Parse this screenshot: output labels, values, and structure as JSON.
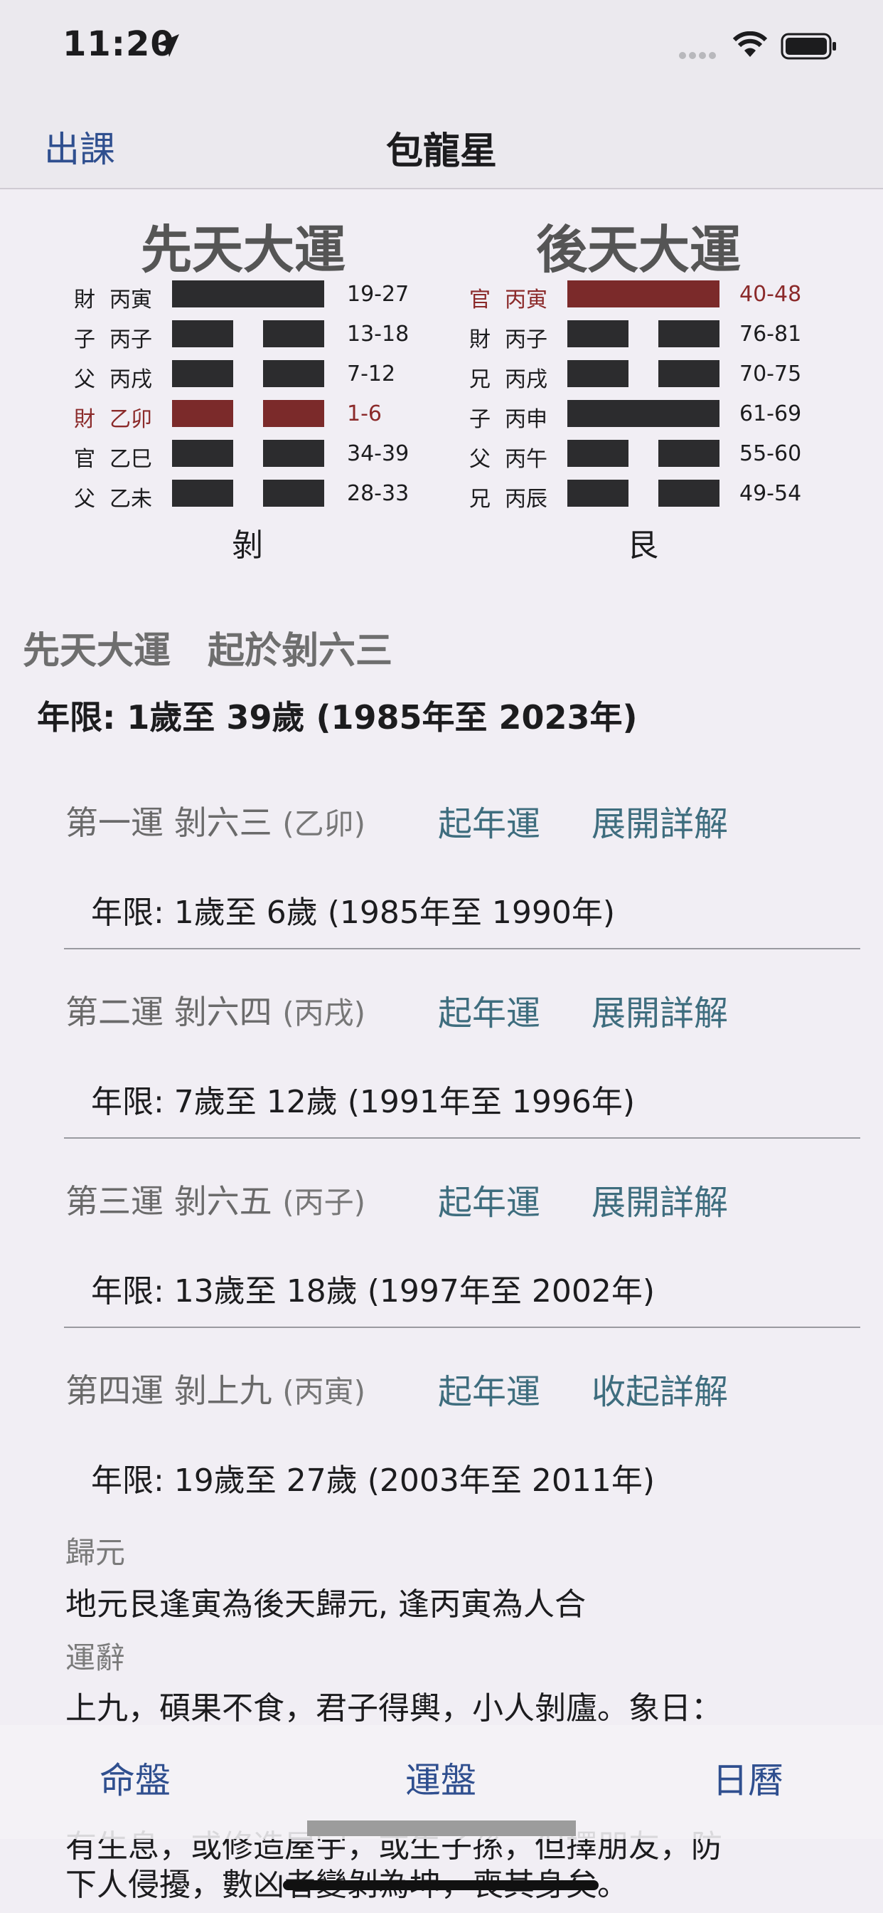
{
  "status": {
    "time": "11:20"
  },
  "nav": {
    "left": "出課",
    "title": "包龍星"
  },
  "panels": {
    "left": {
      "title": "先天大運",
      "name": "剝",
      "lines": [
        {
          "rel": "財",
          "gz": "丙寅",
          "age": "19-27",
          "solid": true,
          "active": false
        },
        {
          "rel": "子",
          "gz": "丙子",
          "age": "13-18",
          "solid": false,
          "active": false
        },
        {
          "rel": "父",
          "gz": "丙戌",
          "age": "7-12",
          "solid": false,
          "active": false
        },
        {
          "rel": "財",
          "gz": "乙卯",
          "age": "1-6",
          "solid": false,
          "active": true
        },
        {
          "rel": "官",
          "gz": "乙巳",
          "age": "34-39",
          "solid": false,
          "active": false
        },
        {
          "rel": "父",
          "gz": "乙未",
          "age": "28-33",
          "solid": false,
          "active": false
        }
      ]
    },
    "right": {
      "title": "後天大運",
      "name": "艮",
      "lines": [
        {
          "rel": "官",
          "gz": "丙寅",
          "age": "40-48",
          "solid": true,
          "active": true
        },
        {
          "rel": "財",
          "gz": "丙子",
          "age": "76-81",
          "solid": false,
          "active": false
        },
        {
          "rel": "兄",
          "gz": "丙戌",
          "age": "70-75",
          "solid": false,
          "active": false
        },
        {
          "rel": "子",
          "gz": "丙申",
          "age": "61-69",
          "solid": true,
          "active": false
        },
        {
          "rel": "父",
          "gz": "丙午",
          "age": "55-60",
          "solid": false,
          "active": false
        },
        {
          "rel": "兄",
          "gz": "丙辰",
          "age": "49-54",
          "solid": false,
          "active": false
        }
      ]
    }
  },
  "section": {
    "title": "先天大運　起於剝六三",
    "range": "年限: 1歲至 39歲 (1985年至 2023年)"
  },
  "yun": [
    {
      "name": "第一運 剝六三",
      "gz": "(乙卯)",
      "start": "起年運",
      "detail": "展開詳解",
      "range": "年限: 1歲至 6歲 (1985年至 1990年)"
    },
    {
      "name": "第二運 剝六四",
      "gz": "(丙戌)",
      "start": "起年運",
      "detail": "展開詳解",
      "range": "年限: 7歲至 12歲 (1991年至 1996年)"
    },
    {
      "name": "第三運 剝六五",
      "gz": "(丙子)",
      "start": "起年運",
      "detail": "展開詳解",
      "range": "年限: 13歲至 18歲 (1997年至 2002年)"
    },
    {
      "name": "第四運 剝上九",
      "gz": "(丙寅)",
      "start": "起年運",
      "detail": "收起詳解",
      "range": "年限: 19歲至 27歲 (2003年至 2011年)"
    }
  ],
  "detail": {
    "gui_label": "歸元",
    "gui_text": "地元艮逢寅為後天歸元, 逢丙寅為人合",
    "ci_label": "運辭",
    "ci_text": "上九，碩果不食，君子得輿，小人剝廬。象日：",
    "partial_1": "有生息，或修造屋宇，或生子孫，但擇朋友，防",
    "partial_2": "下人侵擾，數凶者變剝為坤，喪其身矣。"
  },
  "tabs": [
    "命盤",
    "運盤",
    "日曆"
  ],
  "colors": {
    "accent": "#2f4f8f",
    "link": "#3e6d7e",
    "active_line": "#7b2a2a",
    "line": "#2c2c2e"
  }
}
